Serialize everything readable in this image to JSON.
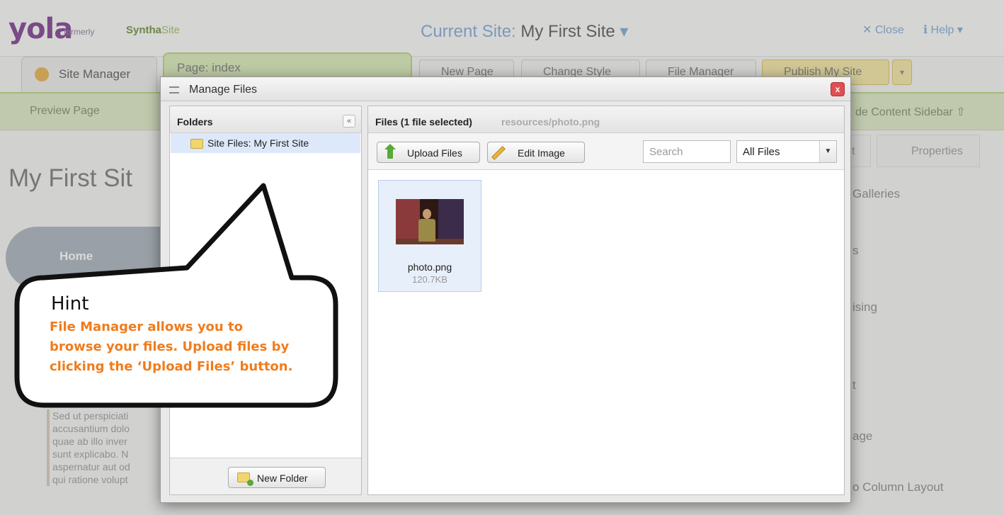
{
  "app": {
    "logo": "yola",
    "logo_formerly": "formerly",
    "logo_synth": "Syntha",
    "logo_site": "Site",
    "current_site_label": "Current Site:",
    "current_site_name": "My First Site",
    "close_label": "Close",
    "help_label": "Help"
  },
  "tabs": {
    "site_manager": "Site Manager",
    "page_label": "Page:",
    "page_value": "index",
    "new_page": "New Page",
    "change_style": "Change Style",
    "file_manager": "File Manager",
    "publish": "Publish My Site"
  },
  "subbar": {
    "preview_page": "Preview Page",
    "hide_sidebar": "de Content Sidebar"
  },
  "sidebar_tabs": {
    "tab_a": "t",
    "properties": "Properties"
  },
  "background": {
    "main_title": "My First Sit",
    "home_nav": "Home",
    "lorem": [
      "Sed ut perspiciati",
      "accusantium dolo",
      "quae ab illo inver",
      "sunt explicabo. N",
      "aspernatur aut od",
      "qui ratione volupt"
    ],
    "right_items": [
      "Galleries",
      "s",
      "ising",
      "t",
      "age",
      "o Column Layout"
    ]
  },
  "modal": {
    "title": "Manage Files",
    "close_glyph": "x",
    "folders_header": "Folders",
    "collapse_glyph": "«",
    "folder_item": "Site Files: My First Site",
    "new_folder": "New Folder",
    "files_header": "Files (1 file selected)",
    "files_path": "resources/photo.png",
    "upload_files": "Upload Files",
    "edit_image": "Edit Image",
    "search_placeholder": "Search",
    "filter_value": "All Files",
    "file": {
      "name": "photo.png",
      "size": "120.7KB"
    }
  },
  "hint": {
    "title": "Hint",
    "lines": [
      "File Manager allows you to",
      "browse your files. Upload files by",
      "clicking the ‘Upload Files’ button."
    ]
  },
  "colors": {
    "hint_text": "#f07c1c",
    "logo": "#7c3a8c",
    "accent_green": "#b9d27a",
    "selection": "#dde9fa"
  }
}
